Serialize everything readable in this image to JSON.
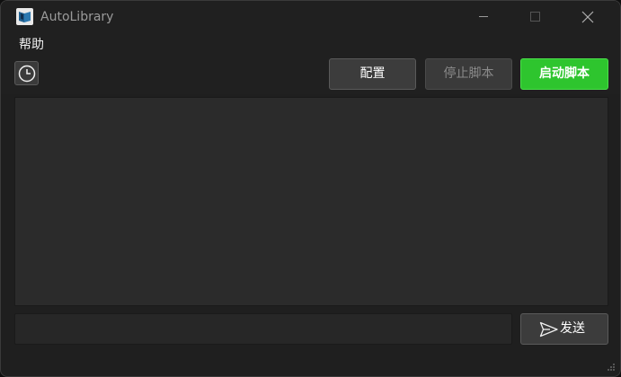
{
  "window": {
    "title": "AutoLibrary",
    "icon": "book-icon"
  },
  "window_controls": {
    "minimize_icon": "minimize-icon",
    "maximize_icon": "maximize-icon",
    "close_icon": "close-icon"
  },
  "menu": {
    "items": [
      {
        "label": "帮助"
      }
    ]
  },
  "toolbar": {
    "history_icon": "clock-icon",
    "config_label": "配置",
    "stop_label": "停止脚本",
    "start_label": "启动脚本"
  },
  "log": {
    "lines": []
  },
  "composer": {
    "input_value": "",
    "input_placeholder": "",
    "send_label": "发送",
    "send_icon": "send-icon"
  },
  "colors": {
    "background": "#1f1f1f",
    "panel": "#2b2b2b",
    "start_button": "#2ec52e",
    "button": "#3c3c3c"
  }
}
